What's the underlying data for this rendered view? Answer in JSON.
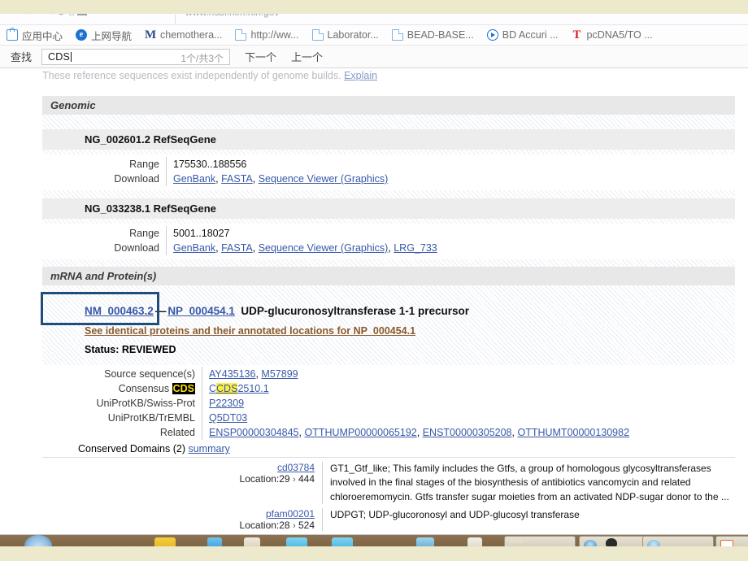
{
  "browser": {
    "bookmarks": [
      {
        "label": "应用中心",
        "icon": "app-bag-icon"
      },
      {
        "label": "上网导航",
        "icon": "browser-e-icon"
      },
      {
        "label": "chemothera...",
        "icon": "mendeley-m-icon"
      },
      {
        "label": "http://ww...",
        "icon": "page-doc-icon"
      },
      {
        "label": "Laborator...",
        "icon": "page-doc-icon"
      },
      {
        "label": "BEAD-BASE...",
        "icon": "page-doc-icon"
      },
      {
        "label": "BD Accuri ...",
        "icon": "play-circle-icon"
      },
      {
        "label": "pcDNA5/TO ...",
        "icon": "red-t-icon"
      }
    ]
  },
  "findbar": {
    "label": "查找",
    "value": "CDS",
    "placeholder": "",
    "count": "1个/共3个",
    "next": "下一个",
    "previous": "上一个"
  },
  "page": {
    "cutoff_note": "These reference sequences exist independently of genome builds.",
    "cutoff_note_link": "Explain",
    "sections": [
      {
        "title": "Genomic",
        "records": [
          {
            "name": "NG_002601.2 RefSeqGene",
            "rows": [
              {
                "key": "Range",
                "value": "175530..188556"
              },
              {
                "key": "Download",
                "links": [
                  "GenBank",
                  "FASTA",
                  "Sequence Viewer (Graphics)"
                ]
              }
            ]
          },
          {
            "name": "NG_033238.1 RefSeqGene",
            "rows": [
              {
                "key": "Range",
                "value": "5001..18027"
              },
              {
                "key": "Download",
                "links": [
                  "GenBank",
                  "FASTA",
                  "Sequence Viewer (Graphics)",
                  "LRG_733"
                ]
              }
            ]
          }
        ]
      },
      {
        "title": "mRNA and Protein(s)",
        "record": {
          "mrna_accession": "NM_000463.2",
          "separator": "—",
          "protein_accession": "NP_000454.1",
          "description": "UDP-glucuronosyltransferase 1-1 precursor",
          "identical_proteins_link": "See identical proteins and their annotated locations for NP_000454.1",
          "status": "Status: REVIEWED",
          "details": [
            {
              "key": "Source sequence(s)",
              "links": [
                "AY435136",
                "M57899"
              ]
            },
            {
              "key_prefix": "Consensus ",
              "key_highlight": "CDS",
              "value_pre": "C",
              "value_highlight": "CDS",
              "value_post": "2510.1"
            },
            {
              "key": "UniProtKB/Swiss-Prot",
              "links": [
                "P22309"
              ]
            },
            {
              "key": "UniProtKB/TrEMBL",
              "links": [
                "Q5DT03"
              ]
            },
            {
              "key": "Related",
              "links": [
                "ENSP00000304845",
                "OTTHUMP00000065192",
                "ENST00000305208",
                "OTTHUMT00000130982"
              ]
            }
          ],
          "conserved_domains_label": "Conserved Domains (2)",
          "conserved_domains_link": "summary",
          "domains": [
            {
              "accession": "cd03784",
              "location_label": "Location:29",
              "location_end": "444",
              "description": "GT1_Gtf_like; This family includes the Gtfs, a group of homologous glycosyltransferases involved in the final stages of the biosynthesis of antibiotics vancomycin and related chloroeremomycin. Gtfs transfer sugar moieties from an activated NDP-sugar donor to the ..."
            },
            {
              "accession": "pfam00201",
              "location_label": "Location:28",
              "location_end": "524",
              "description": "UDPGT; UDP-glucoronosyl and UDP-glucosyl transferase"
            }
          ]
        }
      }
    ]
  },
  "colors": {
    "highlight_box": "#1f4e79",
    "active_find_bg": "#000000",
    "active_find_text": "#ffe000",
    "find_match_bg": "#ffef3f",
    "link": "#3858a8",
    "section_header_bg": "#e8e8e8"
  }
}
